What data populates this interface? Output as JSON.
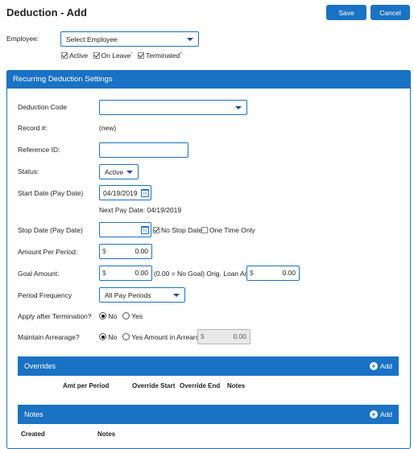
{
  "header": {
    "title": "Deduction  - Add",
    "save_label": "Save",
    "cancel_label": "Cancel"
  },
  "employee": {
    "label": "Employee:",
    "select_value": "Select Employee",
    "filters": [
      {
        "label": "Active",
        "checked": true
      },
      {
        "label": "On Leave",
        "checked": true
      },
      {
        "label": "Terminated",
        "checked": true
      }
    ],
    "required_mark": "*"
  },
  "panel": {
    "title": "Recurring Deduction Settings",
    "fields": {
      "deduction_code_label": "Deduction Code",
      "deduction_code_value": "",
      "record_label": "Record #:",
      "record_value": "(new)",
      "reference_label": "Reference ID:",
      "reference_value": "",
      "status_label": "Status:",
      "status_value": "Active",
      "start_label": "Start Date (Pay Date)",
      "start_value": "04/19/2019",
      "next_pay_date": "Next Pay Date: 04/19/2019",
      "stop_label": "Stop Date (Pay Date)",
      "stop_value": "",
      "no_stop_date": "No Stop Date",
      "one_time_only": "One Time Only",
      "amount_label": "Amount Per Period:",
      "amount_value": "0.00",
      "currency": "$",
      "goal_label": "Goal Amount:",
      "goal_value": "0.00",
      "goal_note": "(0.00 = No Goal) Orig. Loan Amt:",
      "orig_loan_value": "0.00",
      "frequency_label": "Period Frequency",
      "frequency_value": "All Pay Periods",
      "apply_label": "Apply after Termination?",
      "apply_no": "No",
      "apply_yes": "Yes",
      "arrearage_label": "Maintain Arrearage?",
      "arrearage_no": "No",
      "arrearage_yes": "Yes Amount in Arrears:",
      "arrears_value": "0.00"
    },
    "overrides": {
      "title": "Overrides",
      "add_label": "Add",
      "columns": [
        "Amt per Period",
        "Override Start",
        "Override End",
        "Notes"
      ]
    },
    "notes": {
      "title": "Notes",
      "add_label": "Add",
      "columns": [
        "Created",
        "Notes"
      ]
    }
  },
  "colors": {
    "accent": "#1a72c4",
    "required": "#d9232e"
  }
}
